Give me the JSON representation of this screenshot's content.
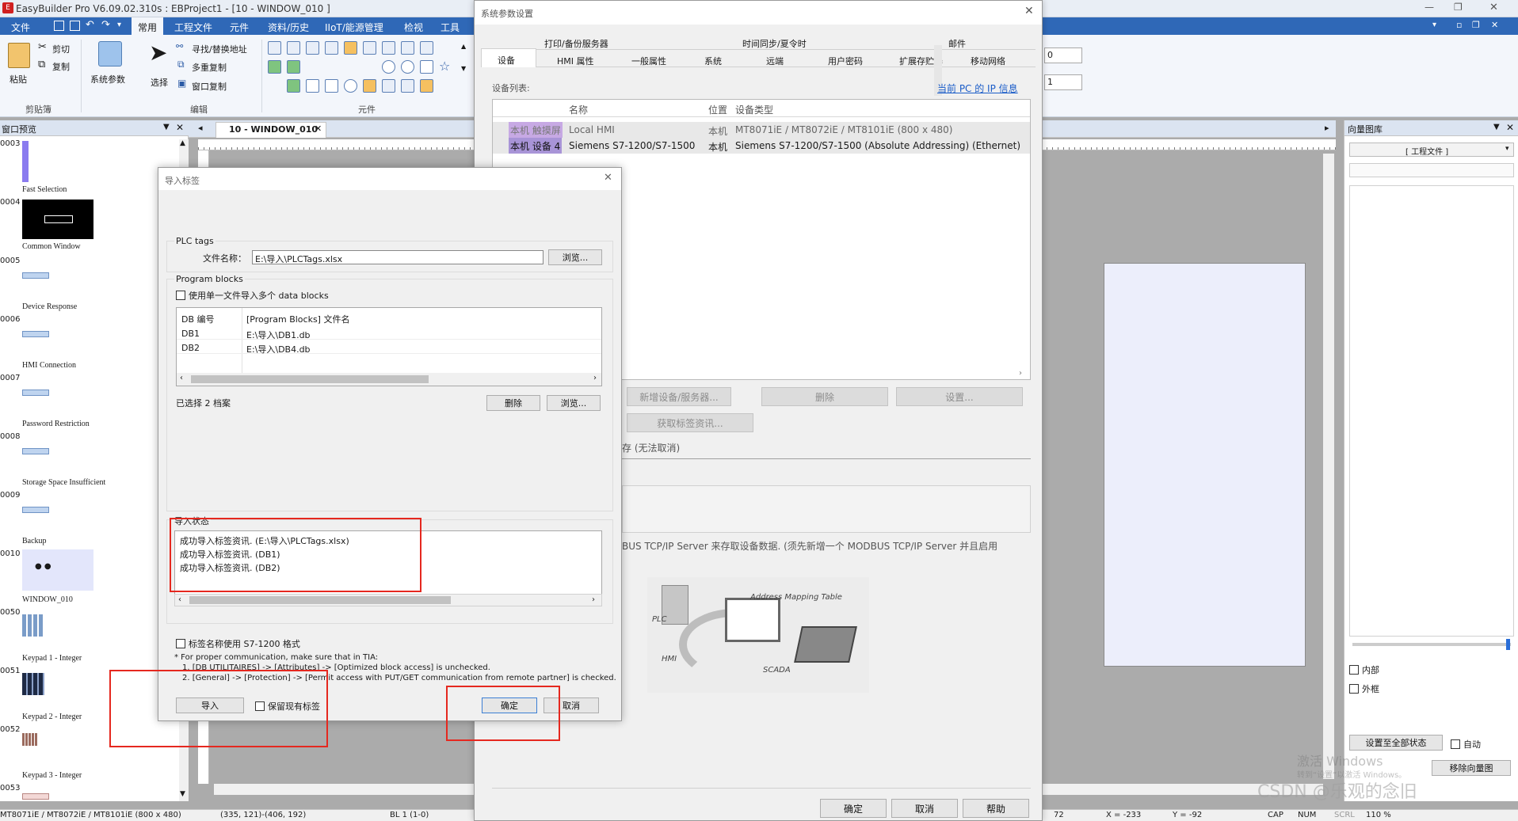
{
  "app": {
    "title": "EasyBuilder Pro V6.09.02.310s : EBProject1 - [10 - WINDOW_010 ]",
    "menu": [
      "文件",
      "常用",
      "工程文件",
      "元件",
      "资料/历史",
      "IIoT/能源管理",
      "检视",
      "工具"
    ],
    "ribbon": {
      "paste": "粘贴",
      "cut": "剪切",
      "copy": "复制",
      "sysparam": "系统参数",
      "select": "选择",
      "find": "寻找/替换地址",
      "multicopy": "多重复制",
      "wincopy": "窗口复制",
      "group_clipboard": "剪贴簿",
      "group_edit": "编辑",
      "group_elements": "元件"
    },
    "spin1": "0",
    "spin2": "1"
  },
  "left_panel": {
    "title": "窗口预览",
    "items": [
      {
        "num": "0003",
        "label": "Fast Selection"
      },
      {
        "num": "0004",
        "label": "Common Window"
      },
      {
        "num": "0005",
        "label": "Device Response"
      },
      {
        "num": "0006",
        "label": "HMI Connection"
      },
      {
        "num": "0007",
        "label": "Password Restriction"
      },
      {
        "num": "0008",
        "label": "Storage Space Insufficient"
      },
      {
        "num": "0009",
        "label": "Backup"
      },
      {
        "num": "0010",
        "label": "WINDOW_010"
      },
      {
        "num": "0050",
        "label": "Keypad 1 - Integer"
      },
      {
        "num": "0051",
        "label": "Keypad 2 - Integer"
      },
      {
        "num": "0052",
        "label": "Keypad 3 - Integer"
      },
      {
        "num": "0053",
        "label": ""
      }
    ]
  },
  "editor": {
    "tab": "10 - WINDOW_010"
  },
  "right_panel": {
    "title": "向量图库",
    "combo": "[ 工程文件 ]",
    "chk_inner": "内部",
    "chk_outer": "外框",
    "btn_all": "设置至全部状态",
    "chk_auto": "自动",
    "btn_tip": "移除向量图",
    "watermark1": "激活 Windows",
    "watermark2": "转到“设置”以激活 Windows。",
    "watermark3": "CSDN @乐观的念旧"
  },
  "statusbar": {
    "model": "MT8071iE / MT8072iE / MT8101iE (800 x 480)",
    "coords": "(335, 121)-(406, 192)",
    "bl": "BL 1 (1-0)",
    "n72": "72",
    "x": "X = -233",
    "y": "Y = -92",
    "cap": "CAP",
    "num": "NUM",
    "scrl": "SCRL",
    "zoom": "110 %"
  },
  "sysdlg": {
    "title": "系统参数设置",
    "tabs_row1": [
      "打印/备份服务器",
      "时间同步/夏令时",
      "邮件"
    ],
    "tabs_row2": [
      "设备",
      "HMI 属性",
      "一般属性",
      "系统",
      "远端",
      "用户密码",
      "扩展存贮器",
      "移动网络"
    ],
    "device_list_label": "设备列表:",
    "ip_link": "当前 PC 的 IP 信息",
    "columns": [
      "名称",
      "位置",
      "设备类型"
    ],
    "rows": [
      {
        "tag": "本机 触摸屏",
        "name": "Local HMI",
        "loc": "本机",
        "type": "MT8071iE / MT8072iE / MT8101iE (800 x 480)"
      },
      {
        "tag": "本机 设备 4",
        "name": "Siemens S7-1200/S7-1500",
        "loc": "本机",
        "type": "Siemens S7-1200/S7-1500 (Absolute Addressing) (Ethernet)"
      }
    ],
    "btn_new": "新增设备/服务器...",
    "btn_del": "删除",
    "btn_set": "设置...",
    "btn_get": "获取标签资讯...",
    "note": "存 (无法取消)",
    "modbus_text": "BUS TCP/IP Server 来存取设备数据. (须先新增一个 MODBUS TCP/IP Server 并且启用",
    "diagram": {
      "amt": "Address Mapping Table",
      "plc": "PLC",
      "hmi": "HMI",
      "scada": "SCADA"
    },
    "btn_ok": "确定",
    "btn_cancel": "取消",
    "btn_help": "帮助"
  },
  "importdlg": {
    "title": "导入标签",
    "plc_tags": "PLC tags",
    "filename_label": "文件名称：",
    "filename": "E:\\导入\\PLCTags.xlsx",
    "browse": "浏览...",
    "program_blocks": "Program blocks",
    "single_file": "使用单一文件导入多个 data blocks",
    "col_db": "DB 编号",
    "col_file": "[Program Blocks] 文件名",
    "db_rows": [
      {
        "db": "DB1",
        "file": "E:\\导入\\DB1.db"
      },
      {
        "db": "DB2",
        "file": "E:\\导入\\DB4.db"
      }
    ],
    "selected": "已选择 2 档案",
    "delete": "删除",
    "browse2": "浏览...",
    "status_label": "导入状态",
    "status_lines": [
      "成功导入标签资讯. (E:\\导入\\PLCTags.xlsx)",
      "成功导入标签资讯. (DB1)",
      "成功导入标签资讯. (DB2)"
    ],
    "s7_format": "标签名称使用 S7-1200 格式",
    "note1": "* For proper communication, make sure that in TIA:",
    "note2": "1. [DB UTILITAIRES] -> [Attributes] -> [Optimized block access] is unchecked.",
    "note3": "2. [General] -> [Protection] -> [Permit access with PUT/GET communication from remote partner] is checked.",
    "import_btn": "导入",
    "keep_tags": "保留现有标签",
    "ok": "确定",
    "cancel": "取消"
  }
}
